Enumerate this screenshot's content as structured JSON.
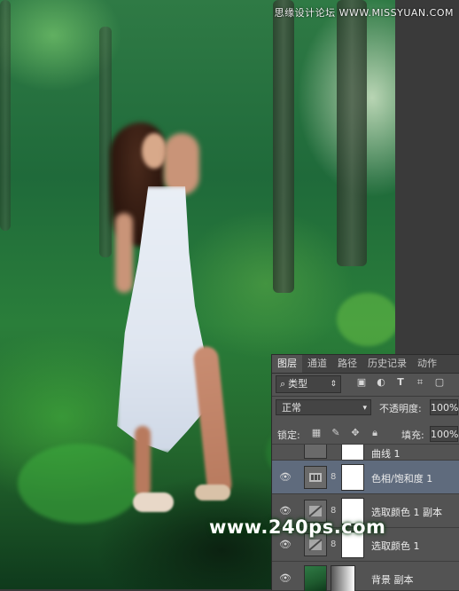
{
  "watermarks": {
    "top": "思缘设计论坛 WWW.MISSYUAN.COM",
    "bottom": "www.240ps.com"
  },
  "layers_panel": {
    "tabs": [
      {
        "label": "图层",
        "active": true
      },
      {
        "label": "通道",
        "active": false
      },
      {
        "label": "路径",
        "active": false
      },
      {
        "label": "历史记录",
        "active": false
      },
      {
        "label": "动作",
        "active": false
      }
    ],
    "filter": {
      "icon": "search-icon",
      "label": "类型"
    },
    "blend_mode": "正常",
    "opacity_label": "不透明度:",
    "opacity_value": "100%",
    "lock_label": "锁定:",
    "fill_label": "填充:",
    "fill_value": "100%",
    "layers": [
      {
        "name": "曲线 1",
        "selected": false,
        "type": "adjustment"
      },
      {
        "name": "色相/饱和度 1",
        "selected": true,
        "type": "adjustment"
      },
      {
        "name": "选取颜色 1 副本",
        "selected": false,
        "type": "adjustment"
      },
      {
        "name": "选取颜色 1",
        "selected": false,
        "type": "adjustment"
      },
      {
        "name": "背景 副本",
        "selected": false,
        "type": "pixel"
      }
    ]
  },
  "colors": {
    "panel_bg": "#535353",
    "selected_layer": "#5f6b7d"
  }
}
